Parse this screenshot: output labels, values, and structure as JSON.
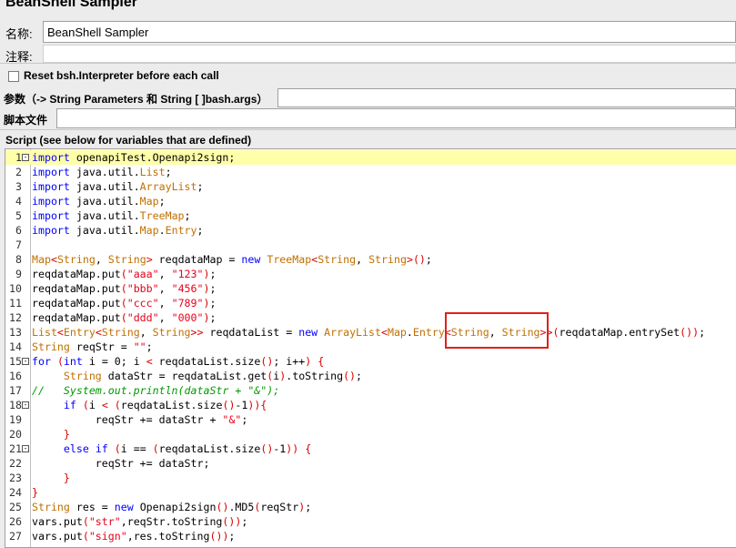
{
  "window": {
    "title": "BeanShell Sampler"
  },
  "form": {
    "name_label": "名称:",
    "name_value": "BeanShell Sampler",
    "comment_label": "注释:",
    "comment_value": "",
    "reset_label": "Reset bsh.Interpreter before each call",
    "reset_checked": false,
    "params_label": "参数（-> String Parameters 和 String [ ]bash.args）",
    "params_value": "",
    "script_file_label": "脚本文件",
    "script_file_value": "",
    "script_label": "Script (see below for variables that are defined)"
  },
  "script": {
    "current_line": 1,
    "lines": [
      "import openapiTest.Openapi2sign;",
      "import java.util.List;",
      "import java.util.ArrayList;",
      "import java.util.Map;",
      "import java.util.TreeMap;",
      "import java.util.Map.Entry;",
      "",
      "Map<String, String> reqdataMap = new TreeMap<String, String>();",
      "reqdataMap.put(\"aaa\", \"123\");",
      "reqdataMap.put(\"bbb\", \"456\");",
      "reqdataMap.put(\"ccc\", \"789\");",
      "reqdataMap.put(\"ddd\", \"000\");",
      "List<Entry<String, String>> reqdataList = new ArrayList<Map.Entry<String, String>>(reqdataMap.entrySet());",
      "String reqStr = \"\";",
      "for (int i = 0; i < reqdataList.size(); i++) {",
      "     String dataStr = reqdataList.get(i).toString();",
      "//   System.out.println(dataStr + \"&\");",
      "     if (i < (reqdataList.size()-1)){",
      "          reqStr += dataStr + \"&\";",
      "     }",
      "     else if (i == (reqdataList.size()-1)) {",
      "          reqStr += dataStr;",
      "     }",
      "}",
      "String res = new Openapi2sign().MD5(reqStr);",
      "vars.put(\"str\",reqStr.toString());",
      "vars.put(\"sign\",res.toString());"
    ],
    "fold_lines": [
      1,
      15,
      18,
      21
    ]
  },
  "colors": {
    "keyword": "#0000ff",
    "type": "#c07000",
    "string": "#e8001c",
    "comment": "#009900",
    "current_line": "#ffffaa",
    "annotation": "#e0201c"
  }
}
